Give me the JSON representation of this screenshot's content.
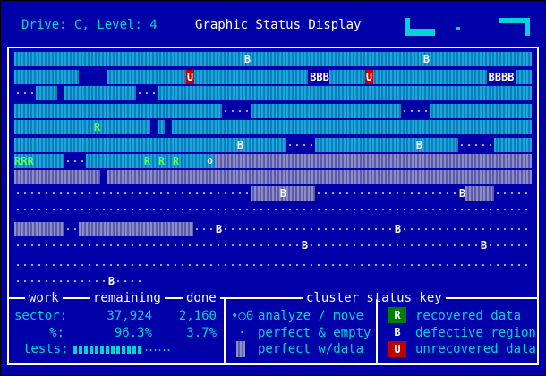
{
  "header": {
    "drive_level": "Drive: C, Level: 4",
    "title": "Graphic Status Display"
  },
  "map_marks": {
    "defective": "B",
    "defective_triple": "BBB",
    "defective_quad": "BBBB",
    "unrecovered": "U",
    "recovered": "R",
    "recovered_triple": "RRR",
    "analyze": "o"
  },
  "status": {
    "col_work": "work",
    "col_remaining": "remaining",
    "col_done": "done",
    "key_title": "cluster status key",
    "sector_label": "sector:",
    "sector_remaining": "37,924",
    "sector_done": "2,160",
    "pct_label": "%:",
    "pct_remaining": "96.3%",
    "pct_done": "3.7%",
    "tests_label": "tests:",
    "tests_progress": 0.7
  },
  "key": {
    "analyze_symbol": "•○0",
    "analyze_label": "analyze / move",
    "empty_symbol": "·",
    "empty_label": "perfect & empty",
    "data_label": "perfect w/data",
    "recovered_symbol": "R",
    "recovered_label": "recovered data",
    "defective_symbol": "B",
    "defective_label": "defective region",
    "unrecovered_symbol": "U",
    "unrecovered_label": "unrecovered data"
  },
  "colors": {
    "background": "#0000a8",
    "cyan": "#00d4d4",
    "recovered": "#5cf85c",
    "unrecovered": "#c00000"
  }
}
